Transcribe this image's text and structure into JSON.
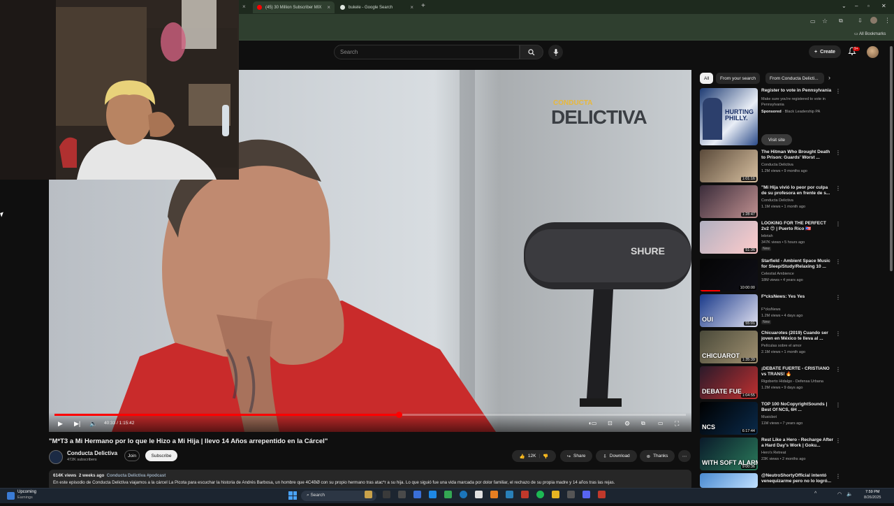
{
  "browser": {
    "tabs": [
      {
        "label": "(45) 30 Million Subscriber MIX",
        "favicon_color": "#ff0000",
        "active": true
      },
      {
        "label": "bukele - Google Search",
        "favicon_color": "#4285f4",
        "active": false
      }
    ],
    "bookmarks_label": "All Bookmarks"
  },
  "header": {
    "search_placeholder": "Search",
    "create_label": "Create",
    "notification_count": "9+"
  },
  "player": {
    "watermark_top": "CONDUCTA",
    "watermark_bottom": "DELICTIVA",
    "mic_brand": "SHURE",
    "time": "40:33 / 1:15:42",
    "progress": 0.545
  },
  "video": {
    "title": "\"M*T3 a Mi Hermano por lo que le Hizo a Mi Hija | llevo 14 Años arrepentido en la Cárcel\"",
    "channel": "Conducta Delictiva",
    "subscribers": "472K subscribers",
    "join_label": "Join",
    "subscribe_label": "Subscribe",
    "likes": "12K",
    "share_label": "Share",
    "download_label": "Download",
    "thanks_label": "Thanks",
    "views": "614K views",
    "age": "2 weeks ago",
    "tags": "Conducta Delictiva #podcast",
    "description": "En este episodio de Conducta Delictiva viajamos a la cárcel La Picota para escuchar la historia de Andrés Barbosa, un hombre que 4C4BØ con su propio hermano tras atac*r a su hija. Lo que siguió fue una vida marcada por dolor familiar, el rechazo de su propia madre y 14 años tras las rejas."
  },
  "sidebar": {
    "chips": [
      "All",
      "From your search",
      "From Conducta Delicti..."
    ],
    "ad": {
      "title": "Register to vote in Pennsylvania",
      "line1": "Make sure you're registered to vote in",
      "line2": "Pennsylvania",
      "sponsored": "Sponsored",
      "advertiser": "Black Leadership PA",
      "visit_label": "Visit site",
      "thumb_text": "HURTING PHILLY."
    },
    "items": [
      {
        "title": "The Hitman Who Brought Death to Prison: Guards' Worst ...",
        "channel": "Conducta Delictiva",
        "meta": "1.2M views • 9 months ago",
        "duration": "1:01:16",
        "badge": ""
      },
      {
        "title": "\"Mi Hija vivió lo peor por culpa de su profesora en frente de s...",
        "channel": "Conducta Delictiva",
        "meta": "1.1M views • 1 month ago",
        "duration": "1:28:47",
        "badge": ""
      },
      {
        "title": "LOOKING FOR THE PERFECT 2v2 😍 | Puerto Rico 🇵🇷",
        "channel": "lebriah",
        "meta": "347K views • 5 hours ago",
        "duration": "51:36",
        "badge": "New"
      },
      {
        "title": "Starfield - Ambient Space Music for Sleep/Study/Relaxing 10 ...",
        "channel": "Celestial Ambience",
        "meta": "18M views • 4 years ago",
        "duration": "10:00:00",
        "badge": ""
      },
      {
        "title": "F*cksNews: Yes Yes",
        "channel": "F*cksNews",
        "meta": "1.2M views • 4 days ago",
        "duration": "55:01",
        "badge": "New"
      },
      {
        "title": "Chicuarotes (2019)  Cuando ser joven en México te lleva al ...",
        "channel": "Películas sobre el amor",
        "meta": "2.1M views • 1 month ago",
        "duration": "1:35:39",
        "badge": ""
      },
      {
        "title": "¡DEBATE FUERTE - CRISTIANO vs TRANS! 🔥",
        "channel": "Rigoberto Hidalgo - Defensa Urbana",
        "meta": "1.2M views • 9 days ago",
        "duration": "1:04:55",
        "badge": ""
      },
      {
        "title": "TOP 100 NoCopyrightSounds | Best Of NCS, 6H ...",
        "channel": "Musicbot",
        "meta": "11M views • 7 years ago",
        "duration": "6:17:44",
        "badge": ""
      },
      {
        "title": "Rest Like a Hero - Recharge After a Hard Day's Work | Goku...",
        "channel": "Hero's Retreat",
        "meta": "23K views • 2 months ago",
        "duration": "9:00:36",
        "badge": ""
      },
      {
        "title": "@NeutroShortyOfficial intentó venequizarme pero no lo logró...",
        "channel": "",
        "meta": "",
        "duration": "",
        "badge": ""
      }
    ],
    "thumb_texts": {
      "t2": "CHICUAROT",
      "t3": "DEBATE FUE",
      "t4": "OUI",
      "t5": "NCS",
      "t6": "WITH SOFT ALARM"
    }
  },
  "taskbar": {
    "weather_title": "Upcoming",
    "weather_sub": "Earnings",
    "search_label": "Search",
    "time": "7:59 PM",
    "date": "8/26/2025"
  }
}
